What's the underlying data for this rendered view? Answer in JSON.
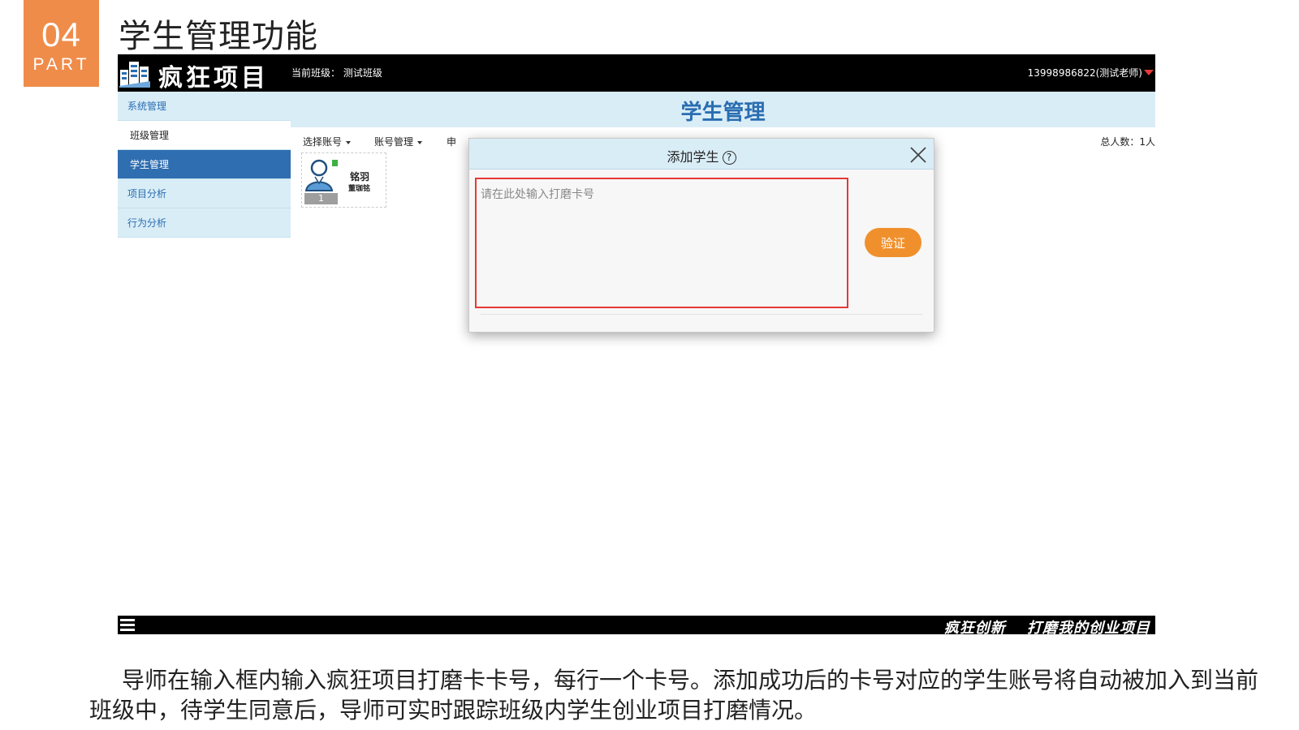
{
  "slide": {
    "part_number": "04",
    "part_label": "PART",
    "title": "学生管理功能",
    "description": "导师在输入框内输入疯狂项目打磨卡卡号，每行一个卡号。添加成功后的卡号对应的学生账号将自动被加入到当前班级中，待学生同意后，导师可实时跟踪班级内学生创业项目打磨情况。"
  },
  "app": {
    "logo_text": "疯狂项目",
    "current_class": "当前班级：  测试班级",
    "user": "13998986822(测试老师)",
    "sidebar": {
      "items": [
        {
          "label": "系统管理"
        },
        {
          "label": "班级管理"
        },
        {
          "label": "学生管理"
        },
        {
          "label": "项目分析"
        },
        {
          "label": "行为分析"
        }
      ]
    },
    "content_title": "学生管理",
    "toolbar": {
      "select_account": "选择账号",
      "account_manage": "账号管理",
      "apply_partial": "申",
      "total_count": "总人数：1人"
    },
    "student": {
      "number": "1",
      "name": "铭羽",
      "sub_name": "董珈铭"
    },
    "modal": {
      "title": "添加学生",
      "help_glyph": "?",
      "input_placeholder": "请在此处输入打磨卡号",
      "input_value": "",
      "verify_label": "验证"
    },
    "footer": {
      "slogan": "疯狂创新　 打磨我的创业项目"
    }
  },
  "colors": {
    "part_badge": "#ef8c4a",
    "topbar": "#000000",
    "sidebar_bg": "#d9edf7",
    "sidebar_active": "#2f6eb0",
    "accent_blue": "#2a6db0",
    "input_border": "#e53935",
    "verify_button": "#f0902c"
  },
  "icons": [
    "logo-building-icon",
    "user-caret-icon",
    "dropdown-caret-icon",
    "student-avatar-icon",
    "help-circle-icon",
    "close-icon",
    "hamburger-menu-icon"
  ]
}
